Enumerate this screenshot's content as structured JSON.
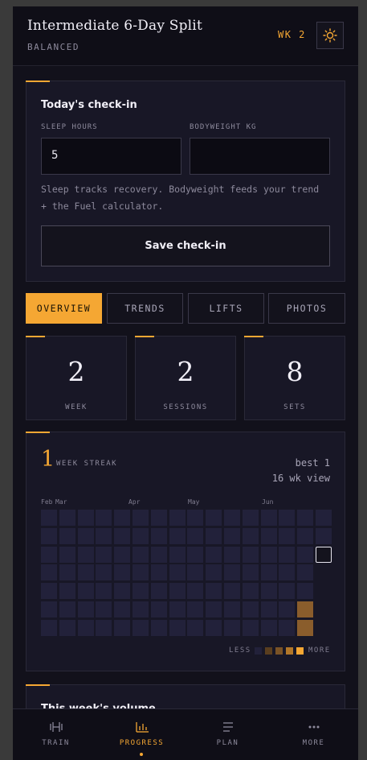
{
  "header": {
    "title": "Intermediate 6-Day Split",
    "subtitle": "BALANCED",
    "week_badge": "WK 2",
    "theme_icon": "sun-icon"
  },
  "checkin": {
    "title": "Today's check-in",
    "sleep_label": "SLEEP HOURS",
    "sleep_value": "5",
    "bodyweight_label": "BODYWEIGHT KG",
    "bodyweight_value": "",
    "helper": "Sleep tracks recovery. Bodyweight feeds your trend + the Fuel calculator.",
    "save_label": "Save check-in"
  },
  "tabs": [
    {
      "label": "OVERVIEW",
      "active": true
    },
    {
      "label": "TRENDS",
      "active": false
    },
    {
      "label": "LIFTS",
      "active": false
    },
    {
      "label": "PHOTOS",
      "active": false
    }
  ],
  "stats": [
    {
      "value": "2",
      "label": "WEEK"
    },
    {
      "value": "2",
      "label": "SESSIONS"
    },
    {
      "value": "8",
      "label": "SETS"
    }
  ],
  "streak": {
    "value": "1",
    "label": "WEEK STREAK",
    "best": "best 1",
    "view": "16 wk view",
    "months": [
      "Feb",
      "Mar",
      "Apr",
      "May",
      "Jun"
    ],
    "weeks": 16,
    "days": 7,
    "active_cells": [
      [
        14,
        5
      ],
      [
        14,
        6
      ]
    ],
    "today_cell": [
      15,
      2
    ],
    "legend_less": "LESS",
    "legend_more": "MORE",
    "colors": {
      "empty": "#22213a",
      "level1": "#5a3e1f",
      "level2": "#7a5326",
      "level3": "#b27729",
      "level4": "#f5a733",
      "active": "#8a5d2c"
    }
  },
  "volume": {
    "title": "This week's volume"
  },
  "nav": [
    {
      "label": "TRAIN",
      "icon": "dumbbell-icon",
      "active": false
    },
    {
      "label": "PROGRESS",
      "icon": "bar-chart-icon",
      "active": true
    },
    {
      "label": "PLAN",
      "icon": "list-icon",
      "active": false
    },
    {
      "label": "MORE",
      "icon": "more-dots-icon",
      "active": false
    }
  ],
  "colors": {
    "accent": "#f5a733",
    "background": "#12111b",
    "card": "#181726"
  }
}
